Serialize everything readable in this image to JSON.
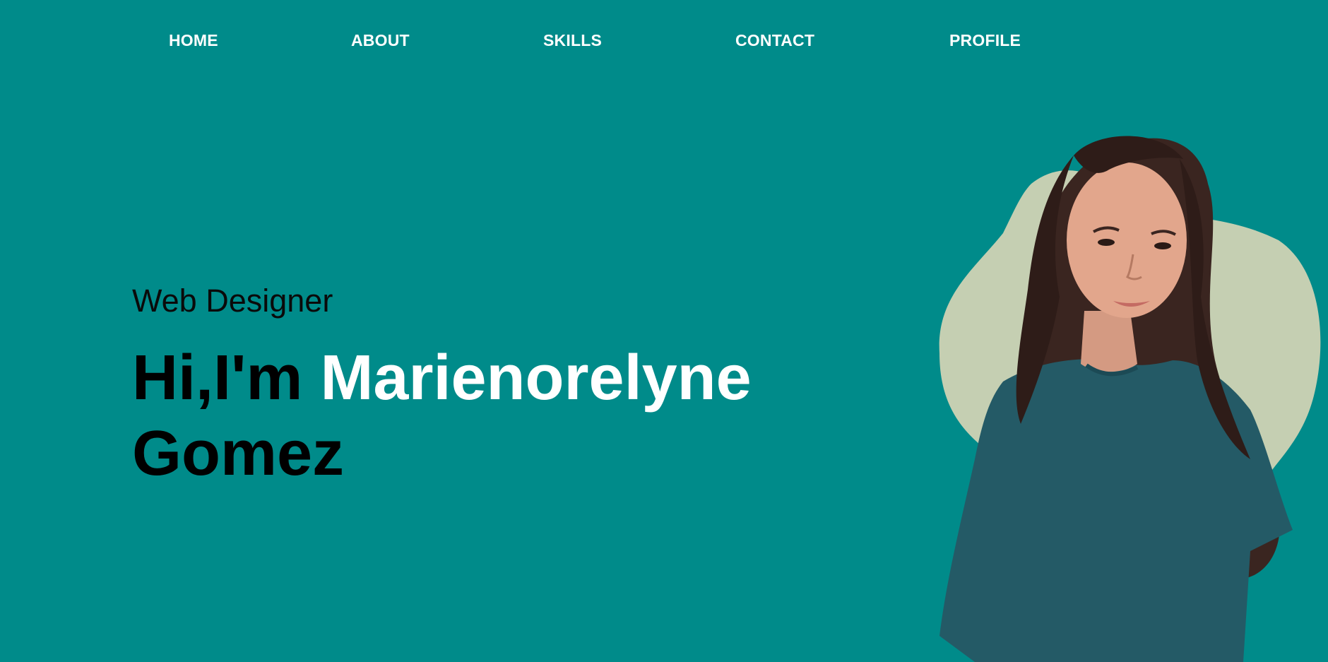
{
  "nav": {
    "items": [
      {
        "label": "HOME"
      },
      {
        "label": "ABOUT"
      },
      {
        "label": "SKILLS"
      },
      {
        "label": "CONTACT"
      },
      {
        "label": "PROFILE"
      }
    ]
  },
  "hero": {
    "subtitle": "Web Designer",
    "greeting": "Hi,I'm ",
    "first_name": "Marienorelyne",
    "last_name": "Gomez"
  },
  "colors": {
    "background": "#008b8a",
    "nav_text": "#ffffff",
    "accent_blob": "#c5cfb2",
    "name_highlight": "#ffffff",
    "heading_text": "#000000"
  },
  "icons": {
    "portrait": "portrait-photo"
  }
}
